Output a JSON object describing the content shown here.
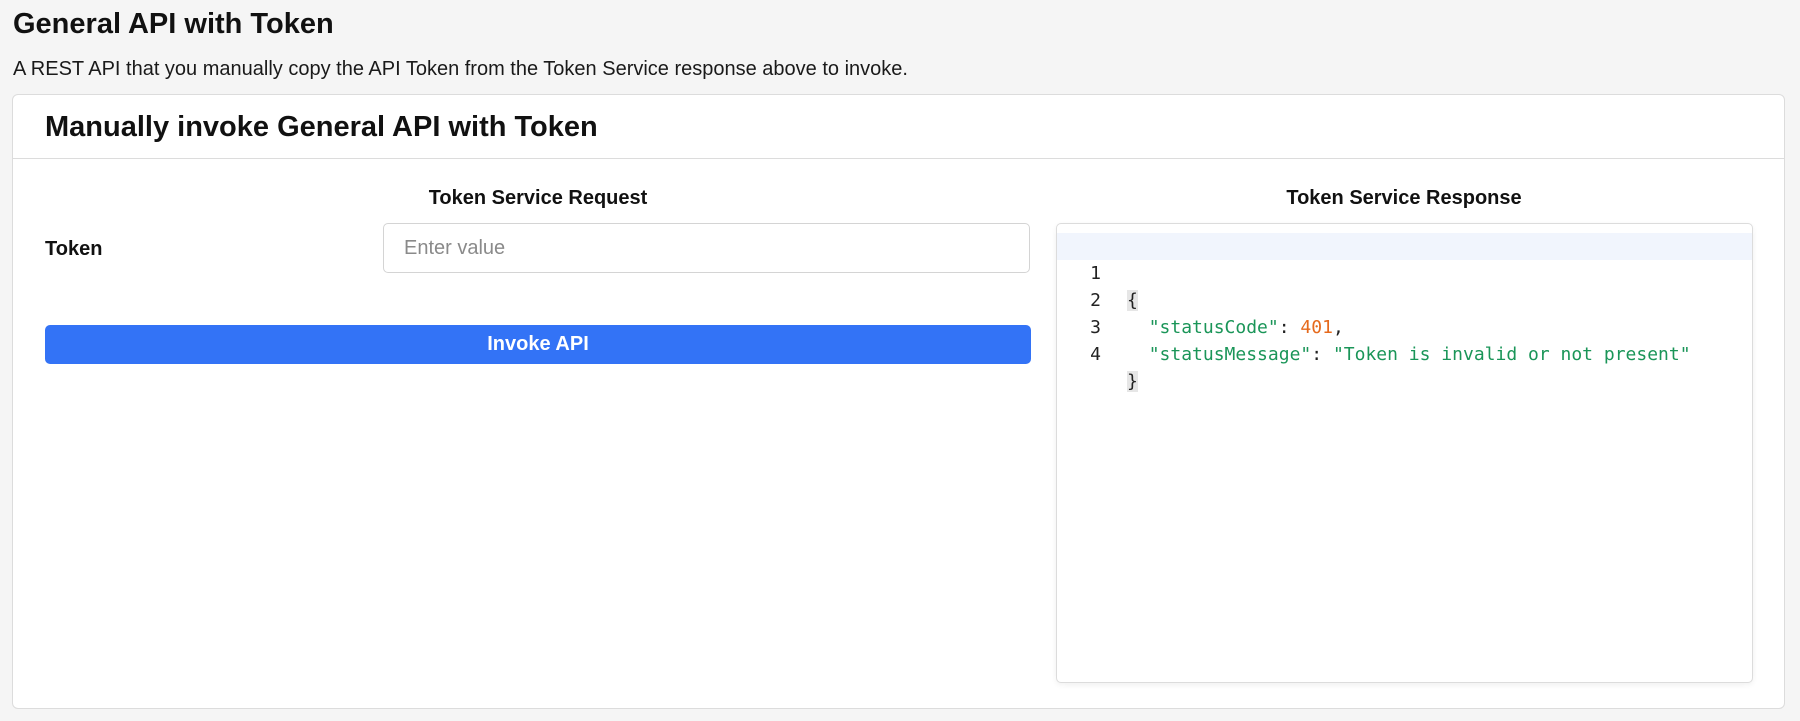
{
  "page": {
    "title": "General API with Token",
    "description": "A REST API that you manually copy the API Token from the Token Service response above to invoke."
  },
  "card": {
    "title": "Manually invoke General API with Token",
    "request": {
      "heading": "Token Service Request",
      "token_label": "Token",
      "token_placeholder": "Enter value",
      "token_value": "",
      "invoke_label": "Invoke API"
    },
    "response": {
      "heading": "Token Service Response",
      "lines": [
        {
          "num": "1",
          "open": "{"
        },
        {
          "num": "2",
          "key": "\"statusCode\"",
          "sep": ": ",
          "value": "401",
          "trail": ","
        },
        {
          "num": "3",
          "key": "\"statusMessage\"",
          "sep": ": ",
          "value": "\"Token is invalid or not present\"",
          "trail": ""
        },
        {
          "num": "4",
          "close": "}"
        }
      ]
    }
  },
  "colors": {
    "accent": "#3373f6",
    "json_key": "#1a9558",
    "json_number": "#e56a1d",
    "json_string": "#1a9558"
  }
}
